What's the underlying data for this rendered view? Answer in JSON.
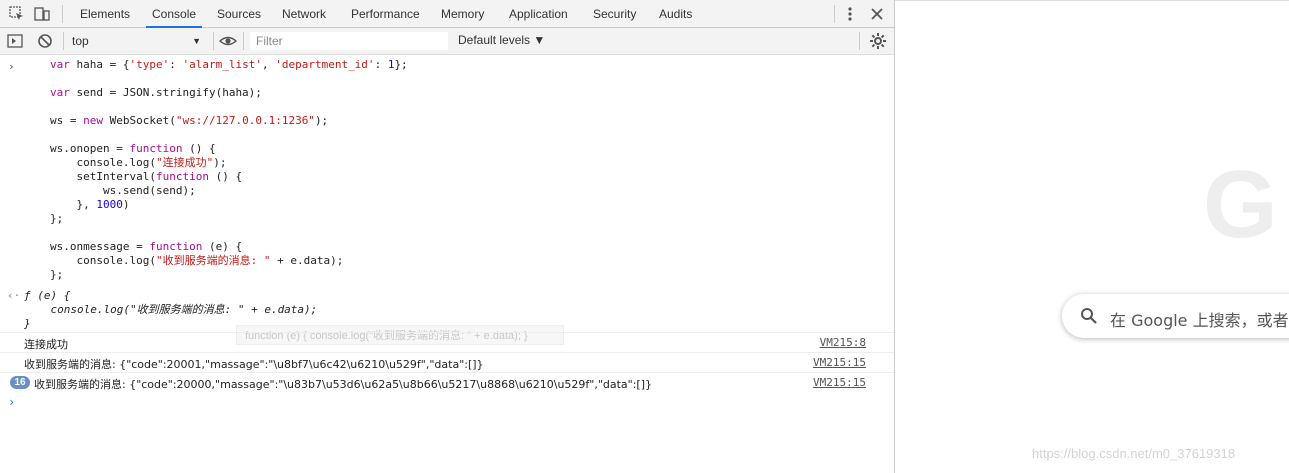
{
  "tabs": {
    "items": [
      "Elements",
      "Console",
      "Sources",
      "Network",
      "Performance",
      "Memory",
      "Application",
      "Security",
      "Audits"
    ],
    "active": "Console"
  },
  "toolbar": {
    "context": "top",
    "filter_placeholder": "Filter",
    "levels": "Default levels ▼"
  },
  "console": {
    "input_code": [
      [
        [
          "k",
          "var"
        ],
        [
          "p",
          " haha = {"
        ],
        [
          "s",
          "'type'"
        ],
        [
          "p",
          ": "
        ],
        [
          "s",
          "'alarm_list'"
        ],
        [
          "p",
          ", "
        ],
        [
          "s",
          "'department_id'"
        ],
        [
          "p",
          ": "
        ],
        [
          "n",
          "1"
        ],
        [
          "p",
          "};"
        ]
      ],
      [],
      [
        [
          "k",
          "var"
        ],
        [
          "p",
          " send = JSON.stringify(haha);"
        ]
      ],
      [],
      [
        [
          "p",
          "ws = "
        ],
        [
          "k",
          "new"
        ],
        [
          "p",
          " WebSocket("
        ],
        [
          "s",
          "\"ws://127.0.0.1:1236\""
        ],
        [
          "p",
          ");"
        ]
      ],
      [],
      [
        [
          "p",
          "ws.onopen = "
        ],
        [
          "k",
          "function"
        ],
        [
          "p",
          " () {"
        ]
      ],
      [
        [
          "p",
          "    console.log("
        ],
        [
          "s",
          "\"连接成功\""
        ],
        [
          "p",
          ");"
        ]
      ],
      [
        [
          "p",
          "    setInterval("
        ],
        [
          "k",
          "function"
        ],
        [
          "p",
          " () {"
        ]
      ],
      [
        [
          "p",
          "        ws.send(send);"
        ]
      ],
      [
        [
          "p",
          "    }, "
        ],
        [
          "n",
          "1000"
        ],
        [
          "p",
          ")"
        ]
      ],
      [
        [
          "p",
          "};"
        ]
      ],
      [],
      [
        [
          "p",
          "ws.onmessage = "
        ],
        [
          "k",
          "function"
        ],
        [
          "p",
          " (e) {"
        ]
      ],
      [
        [
          "p",
          "    console.log("
        ],
        [
          "s",
          "\"收到服务端的消息: \""
        ],
        [
          "p",
          " + e.data);"
        ]
      ],
      [
        [
          "p",
          "};"
        ]
      ]
    ],
    "result_lines": [
      "ƒ (e) {",
      "    console.log(\"收到服务端的消息: \" + e.data);",
      "}"
    ],
    "tooltip": "function (e) { console.log(\"收到服务端的消息: \" + e.data); }",
    "logs": [
      {
        "message": "连接成功",
        "source": "VM215:8",
        "count": ""
      },
      {
        "message": "收到服务端的消息: {\"code\":20001,\"massage\":\"\\u8bf7\\u6c42\\u6210\\u529f\",\"data\":[]}",
        "source": "VM215:15",
        "count": ""
      },
      {
        "message": "收到服务端的消息: {\"code\":20000,\"massage\":\"\\u83b7\\u53d6\\u62a5\\u8b66\\u5217\\u8868\\u6210\\u529f\",\"data\":[]}",
        "source": "VM215:15",
        "count": "16"
      }
    ],
    "prompt": "›"
  },
  "page": {
    "google_letter": "G",
    "search_placeholder": "在 Google 上搜索，或者输",
    "watermark": "https://blog.csdn.net/m0_37619318"
  },
  "colors": {
    "keyword": "#aa0d91",
    "string": "#c41a16",
    "number": "#1c00cf",
    "accent": "#1a73e8"
  }
}
